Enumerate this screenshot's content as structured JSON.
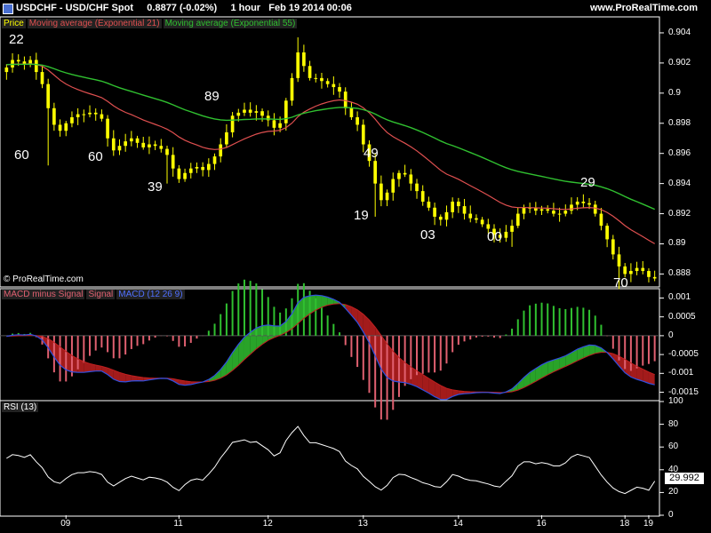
{
  "header": {
    "instrument": "USDCHF - USD/CHF Spot",
    "quote": "0.8877 (-0.02%)",
    "timeframe": "1 hour",
    "datetime": "Feb 19 2014 00:06",
    "site": "www.ProRealTime.com",
    "icon": "chart-icon"
  },
  "watermark": "© ProRealTime.com",
  "price_panel": {
    "legend": [
      "Price",
      "Moving average (Exponential 21)",
      "Moving average (Exponential 55)"
    ],
    "yticks": [
      "0.904",
      "0.902",
      "0.9",
      "0.898",
      "0.896",
      "0.894",
      "0.892",
      "0.89",
      "0.888"
    ],
    "levels": [
      "22",
      "60",
      "60",
      "39",
      "89",
      "49",
      "19",
      "03",
      "00",
      "29",
      "70"
    ]
  },
  "macd_panel": {
    "legend": [
      "MACD minus Signal",
      "Signal",
      "MACD (12 26 9)"
    ],
    "yticks": [
      "0.001",
      "0.0005",
      "0",
      "-0.0005",
      "-0.001",
      "-0.0015"
    ]
  },
  "rsi_panel": {
    "legend": "RSI (13)",
    "yticks": [
      "100",
      "80",
      "60",
      "40",
      "20",
      "0"
    ],
    "current": "29.992"
  },
  "xticks": [
    "09",
    "11",
    "12",
    "13",
    "14",
    "16",
    "18",
    "19"
  ],
  "colors": {
    "candle": "#ffff00",
    "ema21": "#e05050",
    "ema55": "#30c030",
    "macd": "#3050e0",
    "signal": "#c02020",
    "hist_pos": "#30c030",
    "hist_neg": "#e06070",
    "rsi": "#ffffff"
  },
  "chart_data": [
    {
      "type": "candlestick",
      "ylim": [
        0.8872,
        0.905
      ],
      "ema_periods": [
        21,
        55
      ],
      "close": [
        0.9017,
        0.9022,
        0.9021,
        0.9019,
        0.9022,
        0.9014,
        0.9006,
        0.899,
        0.8979,
        0.8975,
        0.898,
        0.8984,
        0.8986,
        0.8986,
        0.8987,
        0.8986,
        0.8983,
        0.897,
        0.8962,
        0.8965,
        0.8968,
        0.897,
        0.8967,
        0.8964,
        0.8966,
        0.8965,
        0.8963,
        0.8959,
        0.895,
        0.8943,
        0.8947,
        0.895,
        0.8951,
        0.8949,
        0.8953,
        0.8958,
        0.8966,
        0.8974,
        0.8985,
        0.8987,
        0.8989,
        0.8987,
        0.8988,
        0.8985,
        0.8982,
        0.8977,
        0.898,
        0.8995,
        0.901,
        0.9027,
        0.9018,
        0.901,
        0.901,
        0.9008,
        0.9006,
        0.9004,
        0.9001,
        0.899,
        0.8984,
        0.8979,
        0.8966,
        0.8955,
        0.894,
        0.8929,
        0.8934,
        0.8943,
        0.8947,
        0.8946,
        0.894,
        0.8935,
        0.8928,
        0.8924,
        0.8918,
        0.8916,
        0.8921,
        0.8928,
        0.8925,
        0.892,
        0.8917,
        0.8916,
        0.8913,
        0.891,
        0.8906,
        0.8904,
        0.8908,
        0.8912,
        0.892,
        0.8924,
        0.8924,
        0.8922,
        0.8923,
        0.8922,
        0.892,
        0.892,
        0.8922,
        0.8926,
        0.8928,
        0.8927,
        0.8926,
        0.892,
        0.8912,
        0.8903,
        0.8893,
        0.8885,
        0.888,
        0.8882,
        0.8884,
        0.8882,
        0.8878,
        0.8877
      ]
    },
    {
      "type": "macd",
      "params": [
        12,
        26,
        9
      ],
      "ylim": [
        -0.0017,
        0.0012
      ]
    },
    {
      "type": "line",
      "name": "RSI (13)",
      "period": 13,
      "ylim": [
        0,
        100
      ],
      "last": 29.992
    }
  ]
}
